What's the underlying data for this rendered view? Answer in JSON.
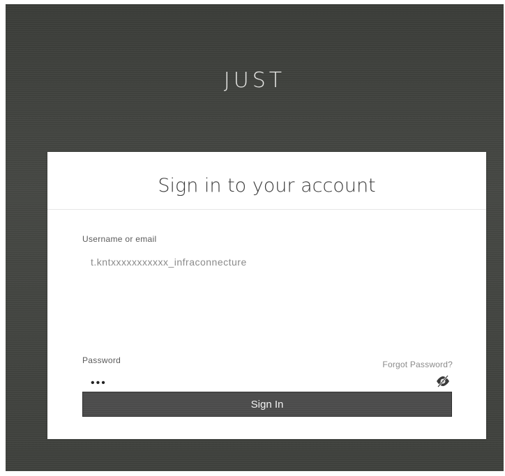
{
  "brand": {
    "name": "JUST"
  },
  "login": {
    "title": "Sign in to your account",
    "username": {
      "label": "Username or email",
      "value": "t.kntxxxxxxxxxxx_infraconnecture"
    },
    "password": {
      "label": "Password",
      "value": "•••",
      "toggle_icon": "eye-slash-icon"
    },
    "forgot_label": "Forgot Password?",
    "submit_label": "Sign In"
  },
  "colors": {
    "background": "#3e403c",
    "card": "#ffffff",
    "button": "#4b4b4b",
    "button_text": "#f2f2f2"
  }
}
